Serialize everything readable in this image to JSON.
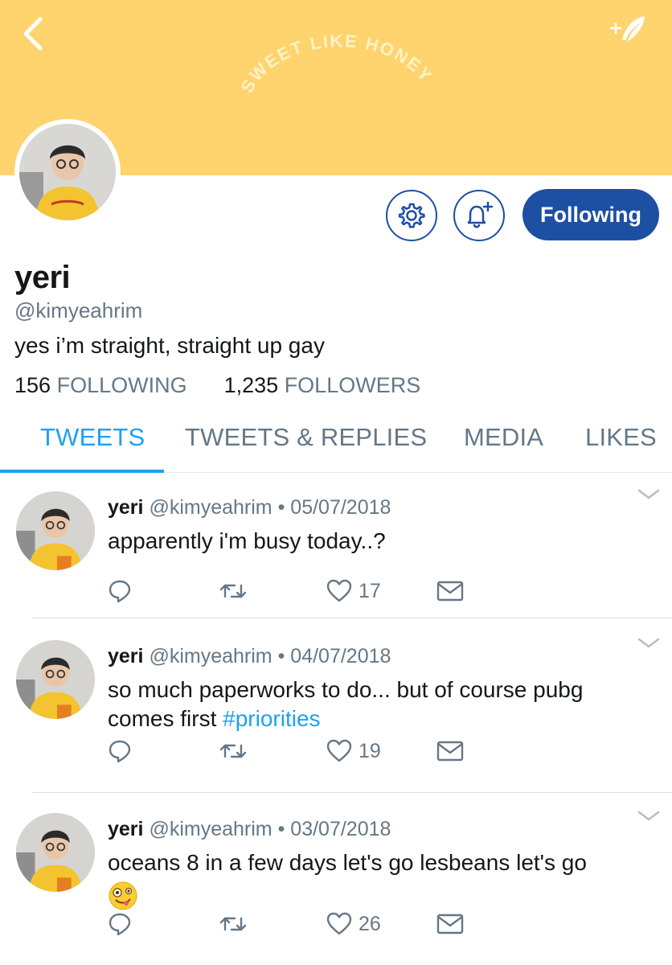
{
  "header": {
    "banner_color": "#ffd36e",
    "banner_text": "SWEET LIKE HONEY",
    "back_icon": "chevron-left-icon",
    "compose_icon": "feather-plus-icon"
  },
  "profile": {
    "name": "yeri",
    "handle": "@kimyeahrim",
    "bio": "yes i’m straight, straight up gay",
    "following_count": "156",
    "following_label": "FOLLOWING",
    "followers_count": "1,235",
    "followers_label": "FOLLOWERS",
    "follow_button_label": "Following"
  },
  "tabs": [
    {
      "label": "TWEETS",
      "active": true
    },
    {
      "label": "TWEETS & REPLIES",
      "active": false
    },
    {
      "label": "MEDIA",
      "active": false
    },
    {
      "label": "LIKES",
      "active": false
    }
  ],
  "tweets": [
    {
      "name": "yeri",
      "handle": "@kimyeahrim",
      "date": "05/07/2018",
      "text": "apparently i'm busy today..?",
      "hashtag": "",
      "like_count": "17"
    },
    {
      "name": "yeri",
      "handle": "@kimyeahrim",
      "date": "04/07/2018",
      "text": "so much paperworks to do... but of course pubg comes first",
      "hashtag": "#priorities",
      "like_count": "19"
    },
    {
      "name": "yeri",
      "handle": "@kimyeahrim",
      "date": "03/07/2018",
      "text": "oceans 8 in a few days let's go lesbeans let's go",
      "hashtag": "",
      "like_count": "26"
    }
  ],
  "colors": {
    "accent": "#1da1f2",
    "button": "#1d4fa3",
    "muted": "#657786"
  }
}
